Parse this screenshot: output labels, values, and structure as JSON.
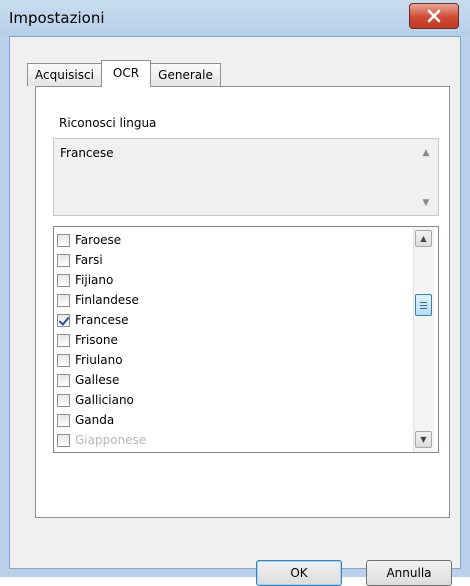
{
  "window": {
    "title": "Impostazioni"
  },
  "tabs": [
    {
      "label": "Acquisisci"
    },
    {
      "label": "OCR",
      "active": true
    },
    {
      "label": "Generale"
    }
  ],
  "ocr": {
    "section_label": "Riconosci lingua",
    "selected_languages_text": "Francese",
    "languages": [
      {
        "label": "Faroese",
        "checked": false
      },
      {
        "label": "Farsi",
        "checked": false
      },
      {
        "label": "Fijiano",
        "checked": false
      },
      {
        "label": "Finlandese",
        "checked": false
      },
      {
        "label": "Francese",
        "checked": true
      },
      {
        "label": "Frisone",
        "checked": false
      },
      {
        "label": "Friulano",
        "checked": false
      },
      {
        "label": "Gallese",
        "checked": false
      },
      {
        "label": "Galliciano",
        "checked": false
      },
      {
        "label": "Ganda",
        "checked": false
      },
      {
        "label": "Giapponese",
        "checked": false
      }
    ]
  },
  "buttons": {
    "ok": "OK",
    "cancel": "Annulla"
  },
  "colors": {
    "accent": "#3c7fb1",
    "close": "#c13b25"
  }
}
